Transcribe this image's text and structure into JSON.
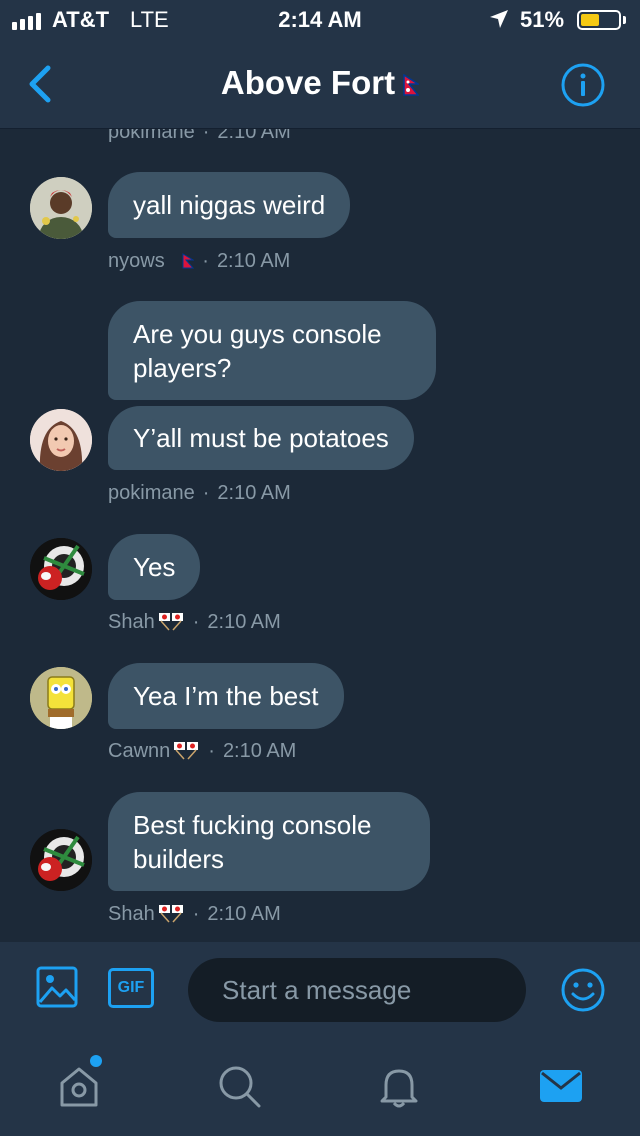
{
  "status_bar": {
    "carrier": "AT&T",
    "network": "LTE",
    "time": "2:14 AM",
    "battery_percent": "51%",
    "battery_level": 0.51,
    "battery_color": "#f5c913"
  },
  "header": {
    "title": "Above Fort",
    "back_icon": "chevron-left-icon",
    "info_icon": "info-icon",
    "accent_color": "#1da1f2"
  },
  "messages": {
    "top_cut_meta": {
      "name": "pokimane",
      "time": "2:10 AM"
    },
    "groups": [
      {
        "sender": "nyows",
        "time": "2:10 AM",
        "bubbles": [
          "yall niggas weird"
        ]
      },
      {
        "sender": "pokimane",
        "time": "2:10 AM",
        "bubbles": [
          "Are you guys console players?",
          "Y’all must be potatoes"
        ]
      },
      {
        "sender": "Shah",
        "time": "2:10 AM",
        "bubbles": [
          "Yes"
        ]
      },
      {
        "sender": "Cawnn",
        "time": "2:10 AM",
        "bubbles": [
          "Yea I’m the best"
        ]
      },
      {
        "sender": "Shah",
        "time": "2:10 AM",
        "bubbles": [
          "Best fucking console builders"
        ]
      }
    ],
    "bubble_color": "#3d5466"
  },
  "composer": {
    "placeholder": "Start a message",
    "gif_label": "GIF",
    "media_icon": "image-icon",
    "emoji_icon": "smiley-icon"
  },
  "tab_bar": {
    "tabs": [
      "home-icon",
      "search-icon",
      "bell-icon",
      "mail-icon"
    ],
    "active": "mail-icon",
    "home_has_notification": true
  },
  "colors": {
    "background": "#1c2938",
    "bar_background": "#243447",
    "meta_text": "#8899a6"
  }
}
